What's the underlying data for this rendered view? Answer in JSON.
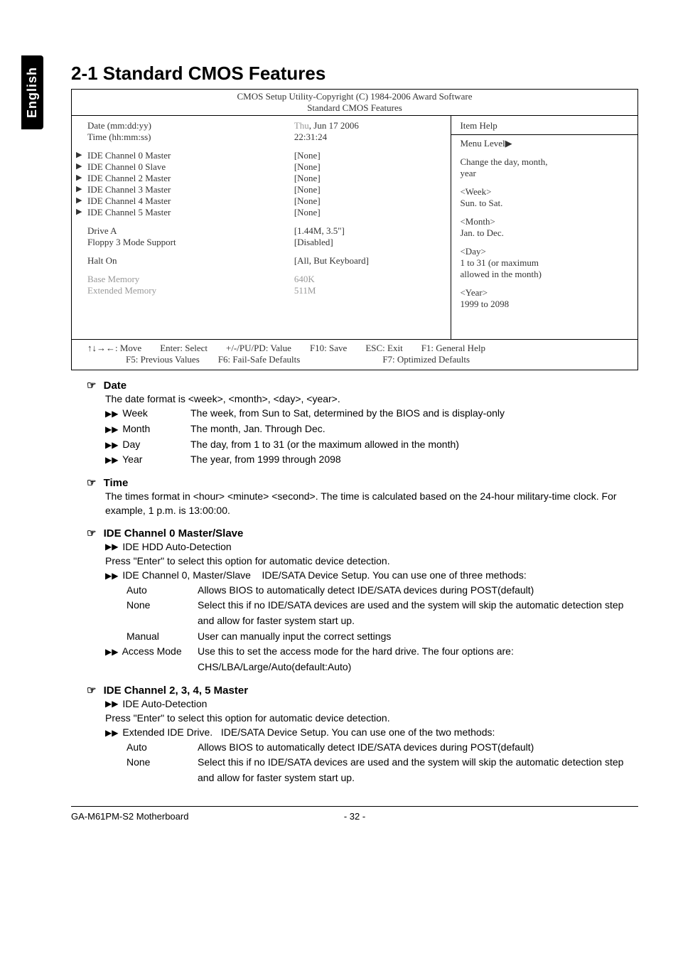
{
  "side_tab": "English",
  "heading": "2-1   Standard CMOS Features",
  "bios": {
    "header_line1": "CMOS Setup Utility-Copyright (C) 1984-2006 Award Software",
    "header_line2": "Standard CMOS Features",
    "rows": {
      "date_label": "Date (mm:dd:yy)",
      "date_value_prefix": "Thu",
      "date_value_rest": ", Jun  17  2006",
      "time_label": "Time (hh:mm:ss)",
      "time_value": "22:31:24",
      "ide0m": "IDE Channel 0 Master",
      "ide0m_v": "[None]",
      "ide0s": "IDE Channel 0 Slave",
      "ide0s_v": "[None]",
      "ide2m": "IDE Channel 2 Master",
      "ide2m_v": "[None]",
      "ide3m": "IDE Channel 3 Master",
      "ide3m_v": "[None]",
      "ide4m": "IDE Channel 4 Master",
      "ide4m_v": "[None]",
      "ide5m": "IDE Channel 5 Master",
      "ide5m_v": "[None]",
      "drivea": "Drive A",
      "drivea_v": "[1.44M, 3.5\"]",
      "floppy3": "Floppy 3 Mode Support",
      "floppy3_v": "[Disabled]",
      "halton": "Halt On",
      "halton_v": "[All, But Keyboard]",
      "basemem": "Base Memory",
      "basemem_v": "640K",
      "extmem": "Extended Memory",
      "extmem_v": "511M"
    },
    "help": {
      "title": "Item Help",
      "menulevel": "Menu Level",
      "line1": "Change the day, month,",
      "line2": "year",
      "week_h": "<Week>",
      "week_t": "Sun. to Sat.",
      "month_h": "<Month>",
      "month_t": "Jan. to Dec.",
      "day_h": "<Day>",
      "day_t1": "1 to 31 (or maximum",
      "day_t2": "allowed in the month)",
      "year_h": "<Year>",
      "year_t": "1999 to 2098"
    },
    "footer": {
      "move": "↑↓→←: Move",
      "enter": "Enter: Select",
      "pupd": "+/-/PU/PD: Value",
      "f10": "F10: Save",
      "esc": "ESC: Exit",
      "f1": "F1: General Help",
      "f5": "F5: Previous Values",
      "f6": "F6: Fail-Safe Defaults",
      "f7": "F7: Optimized Defaults"
    }
  },
  "sections": {
    "date": {
      "title": "Date",
      "intro": "The date format is <week>, <month>, <day>, <year>.",
      "week_l": "Week",
      "week_d": "The week, from Sun to Sat, determined by the BIOS and is display-only",
      "month_l": "Month",
      "month_d": "The month, Jan. Through Dec.",
      "day_l": "Day",
      "day_d": "The day, from 1 to 31 (or the maximum allowed in the month)",
      "year_l": "Year",
      "year_d": "The year, from 1999 through 2098"
    },
    "time": {
      "title": "Time",
      "text": "The times format in <hour> <minute> <second>. The time is calculated based on the 24-hour military-time clock. For example, 1 p.m. is 13:00:00."
    },
    "ide0": {
      "title": "IDE Channel 0 Master/Slave",
      "hdd_auto": "IDE HDD Auto-Detection",
      "hdd_auto_text": "Press \"Enter\" to select this option for automatic device detection.",
      "ch0_label": "IDE Channel 0, Master/Slave",
      "ch0_desc": "IDE/SATA Device Setup.  You can use one of three methods:",
      "auto_l": "Auto",
      "auto_d": "Allows BIOS to automatically detect IDE/SATA devices during POST(default)",
      "none_l": "None",
      "none_d": "Select this if no IDE/SATA devices are used and the system will skip the automatic detection step and allow for faster system start up.",
      "manual_l": "Manual",
      "manual_d": "User can manually input the correct settings",
      "access_l": "Access Mode",
      "access_d": "Use this to set the access mode for the hard drive. The four options are: CHS/LBA/Large/Auto(default:Auto)"
    },
    "ide2345": {
      "title": "IDE Channel 2, 3, 4, 5 Master",
      "auto_det": "IDE Auto-Detection",
      "auto_det_text": "Press \"Enter\" to select this option for automatic device detection.",
      "ext_label": "Extended IDE Drive.",
      "ext_desc": "IDE/SATA Device Setup.  You can use one of the two methods:",
      "auto_l": "Auto",
      "auto_d": "Allows BIOS to automatically detect IDE/SATA devices during POST(default)",
      "none_l": "None",
      "none_d": "Select this if no IDE/SATA devices are used and the system will skip the automatic detection step and allow for faster system start up."
    }
  },
  "footer": {
    "left": "GA-M61PM-S2 Motherboard",
    "mid": "- 32 -"
  }
}
